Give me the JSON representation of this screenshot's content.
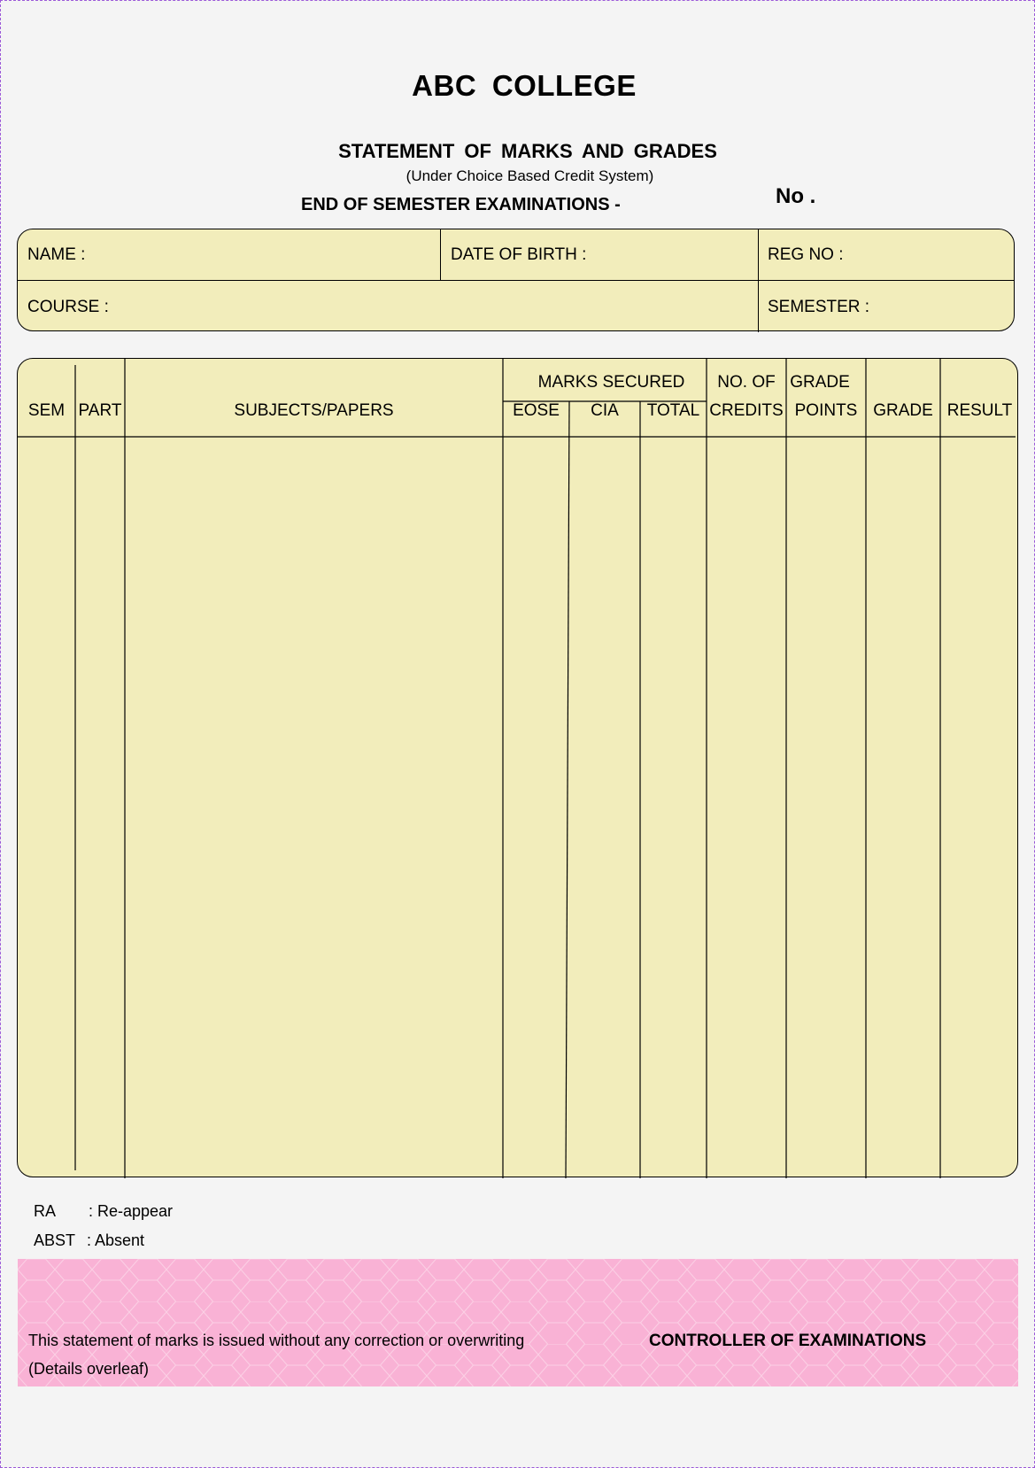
{
  "header": {
    "college_name": "ABC  COLLEGE",
    "statement_title": "STATEMENT  OF  MARKS  AND  GRADES",
    "subtitle": "(Under Choice Based Credit System)",
    "exam_title": "END OF SEMESTER EXAMINATIONS -",
    "number_label": "No ."
  },
  "student_info": {
    "name_label": "NAME  :",
    "dob_label": "DATE OF BIRTH :",
    "reg_label": "REG NO :",
    "course_label": "COURSE  :",
    "semester_label": "SEMESTER :"
  },
  "marks_table": {
    "columns": {
      "sem": "SEM",
      "part": "PART",
      "subjects": "SUBJECTS/PAPERS",
      "marks_secured": "MARKS SECURED",
      "eose": "EOSE",
      "cia": "CIA",
      "total": "TOTAL",
      "credits_line1": "NO. OF",
      "credits_line2": "CREDITS",
      "grade_points_line1": "GRADE",
      "grade_points_line2": "POINTS",
      "grade": "GRADE",
      "result": "RESULT"
    },
    "rows": []
  },
  "legend": [
    {
      "code": "RA",
      "meaning": ": Re-appear"
    },
    {
      "code": "ABST",
      "meaning": ": Absent"
    }
  ],
  "footer": {
    "note_line1": "This statement of marks is issued without any correction or overwriting",
    "note_line2": "(Details overleaf)",
    "signatory": "CONTROLLER OF EXAMINATIONS"
  },
  "colors": {
    "page_background": "#f4f4f4",
    "form_fill": "#f2edbb",
    "footer_band": "#f9b2d5",
    "frame_border": "#9b59d8"
  }
}
